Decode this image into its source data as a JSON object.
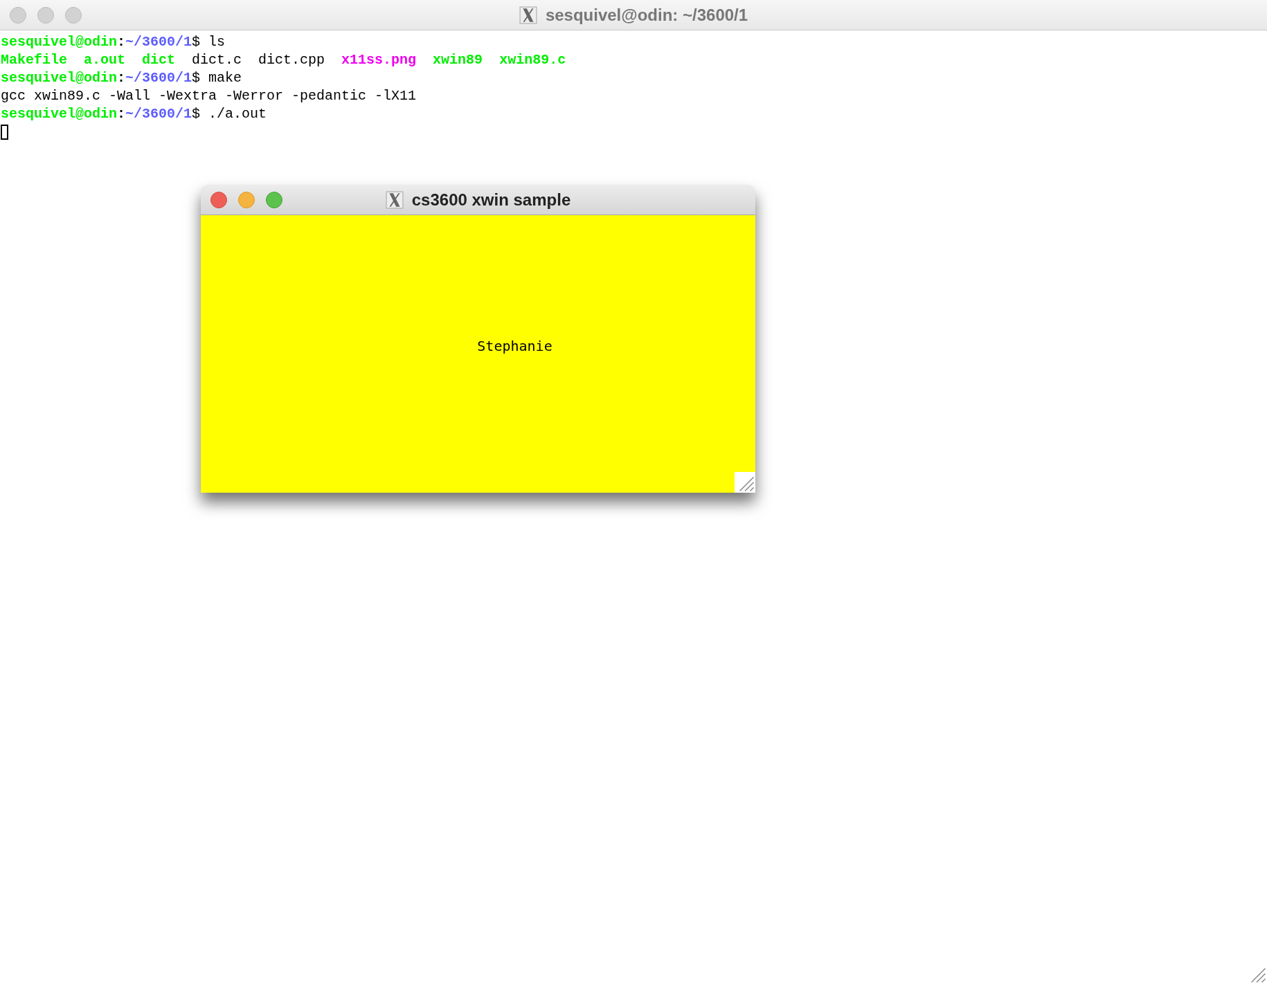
{
  "terminal": {
    "title": "sesquivel@odin: ~/3600/1",
    "active": false,
    "lines": [
      {
        "kind": "prompt",
        "user": "sesquivel@odin",
        "separator": ":",
        "path": "~/3600/1",
        "command": "$ ls"
      },
      {
        "kind": "listing",
        "entries": [
          {
            "name": "Makefile",
            "kind": "exec"
          },
          {
            "name": "a.out",
            "kind": "exec"
          },
          {
            "name": "dict",
            "kind": "exec"
          },
          {
            "name": "dict.c",
            "kind": "file"
          },
          {
            "name": "dict.cpp",
            "kind": "file"
          },
          {
            "name": "x11ss.png",
            "kind": "image"
          },
          {
            "name": "xwin89",
            "kind": "exec"
          },
          {
            "name": "xwin89.c",
            "kind": "exec"
          }
        ]
      },
      {
        "kind": "prompt",
        "user": "sesquivel@odin",
        "separator": ":",
        "path": "~/3600/1",
        "command": "$ make"
      },
      {
        "kind": "output",
        "text": "gcc xwin89.c -Wall -Wextra -Werror -pedantic -lX11"
      },
      {
        "kind": "prompt",
        "user": "sesquivel@odin",
        "separator": ":",
        "path": "~/3600/1",
        "command": "$ ./a.out"
      }
    ]
  },
  "sample_window": {
    "title": "cs3600 xwin sample",
    "active": true,
    "text": "Stephanie"
  }
}
